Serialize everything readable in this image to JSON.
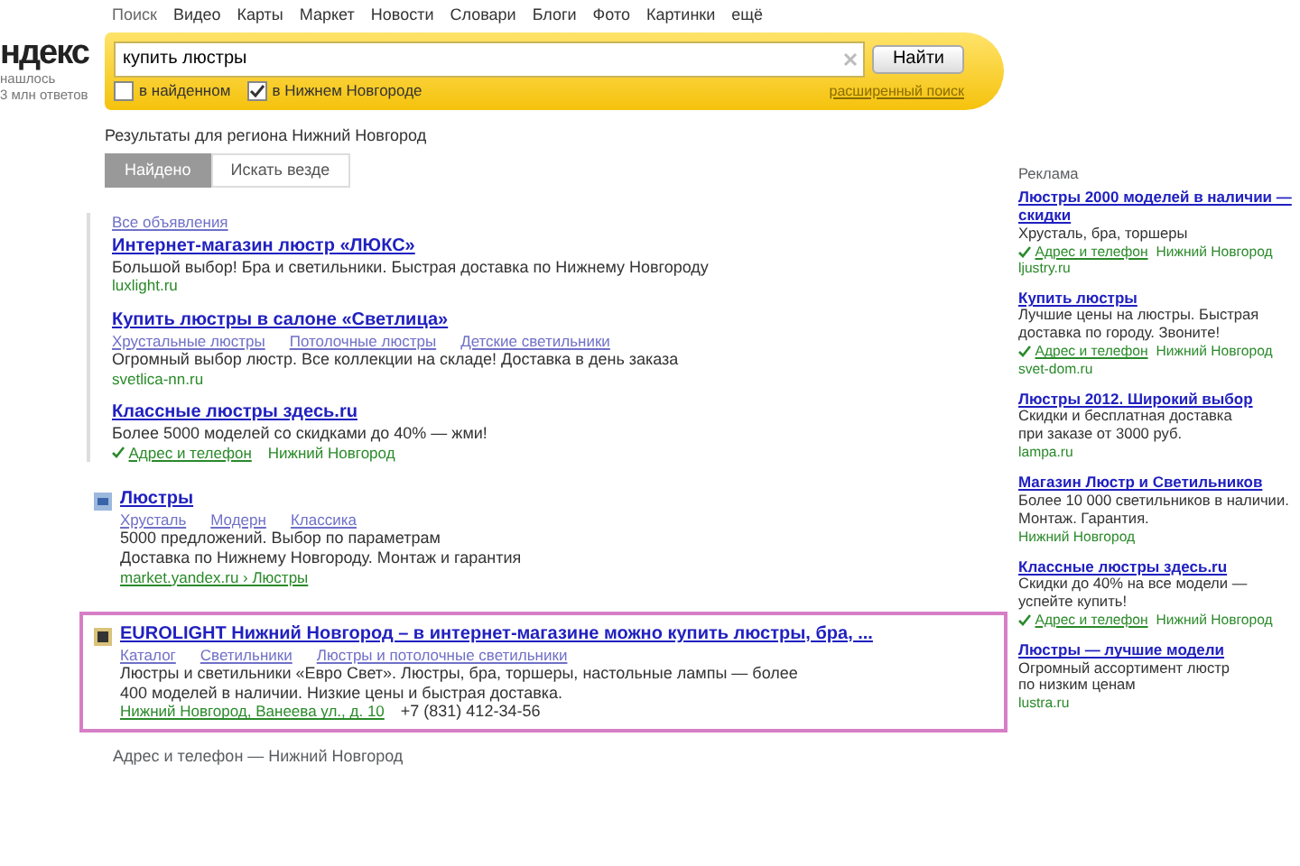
{
  "nav": [
    {
      "label": "Поиск",
      "selected": true
    },
    {
      "label": "Видео",
      "selected": false
    },
    {
      "label": "Карты",
      "selected": false
    },
    {
      "label": "Маркет",
      "selected": false
    },
    {
      "label": "Новости",
      "selected": false
    },
    {
      "label": "Словари",
      "selected": false
    },
    {
      "label": "Блоги",
      "selected": false
    },
    {
      "label": "Фото",
      "selected": false
    },
    {
      "label": "Картинки",
      "selected": false
    },
    {
      "label": "ещё",
      "selected": false
    }
  ],
  "logo": {
    "text": "ндекс",
    "lines": [
      "нашлось",
      "3 млн ответов"
    ]
  },
  "search": {
    "value": "купить люстры",
    "button": "Найти",
    "advanced": "расширенный поиск",
    "options": [
      {
        "label": "в найденном",
        "checked": false
      },
      {
        "label": "в Нижнем Новгороде",
        "checked": true
      }
    ]
  },
  "region_note": "Результаты для региона Нижний Новгород",
  "view_tabs": [
    {
      "label": "Найдено",
      "selected": true
    },
    {
      "label": "Искать везде",
      "selected": false
    }
  ],
  "ads": {
    "header": "Все объявления",
    "items": [
      {
        "title": "Интернет-магазин люстр «ЛЮКС»",
        "lines": [
          "Большой выбор! Бра и светильники. Быстрая доставка по Нижнему Новгороду"
        ],
        "url": "luxlight.ru"
      },
      {
        "title": "Купить люстры в салоне «Светлица»",
        "sitelinks": [
          "Хрустальные люстры",
          "Потолочные люстры",
          "Детские светильники"
        ],
        "lines": [
          "Огромный выбор люстр. Все коллекции на складе! Доставка в день заказа"
        ],
        "url": "svetlica-nn.ru"
      },
      {
        "title": "Классные люстры здесь.ru",
        "lines": [
          "Более 5000 моделей со скидками до 40% — жми!"
        ],
        "contact": "Адрес и телефон",
        "contact_extra": "Нижний Новгород"
      }
    ]
  },
  "results": [
    {
      "kind": "doc",
      "title": "Люстры",
      "sitelinks": [
        "Хрусталь",
        "Модерн",
        "Классика"
      ],
      "lines": [
        "5000 предложений. Выбор по параметрам",
        "Доставка по Нижнему Новгороду. Монтаж и гарантия"
      ],
      "url": "market.yandex.ru › Люстры",
      "highlighted": false
    },
    {
      "kind": "site",
      "title": "EUROLIGHT Нижний Новгород – в интернет-магазине можно купить люстры, бра, ...",
      "sitelinks": [
        "Каталог",
        "Светильники",
        "Люстры и потолочные светильники"
      ],
      "lines": [
        "Люстры и светильники «Евро Свет». Люстры, бра, торшеры, настольные лампы — более",
        "400 моделей в наличии. Низкие цены и быстрая доставка."
      ],
      "url": "Нижний Новгород, Ванеева ул., д. 10",
      "phone": "+7 (831) 412-34-56",
      "highlighted": true
    }
  ],
  "result_footer": "Адрес и телефон — Нижний Новгород",
  "right_ads": {
    "header": "Реклама",
    "items": [
      {
        "title": "Люстры 2000 моделей в наличии — скидки",
        "lines": [
          "Хрусталь, бра, торшеры"
        ],
        "contact": "Адрес и телефон",
        "extra": "Нижний Новгород",
        "url": "ljustry.ru"
      },
      {
        "title": "Купить люстры",
        "lines": [
          "Лучшие цены на люстры. Быстрая",
          "доставка по городу. Звоните!"
        ],
        "contact": "Адрес и телефон",
        "extra": "Нижний Новгород",
        "url": "svet-dom.ru"
      },
      {
        "title": "Люстры 2012. Широкий выбор",
        "lines": [
          "Скидки и бесплатная доставка",
          "при заказе от 3000 руб."
        ],
        "url": "lampa.ru"
      },
      {
        "title": "Магазин Люстр и Светильников",
        "lines": [
          "Более 10 000 светильников в наличии.",
          "Монтаж. Гарантия."
        ],
        "extra": "Нижний Новгород"
      },
      {
        "title": "Классные люстры здесь.ru",
        "lines": [
          "Скидки до 40% на все модели —",
          "успейте купить!"
        ],
        "contact": "Адрес и телефон",
        "extra": "Нижний Новгород"
      },
      {
        "title": "Люстры — лучшие модели",
        "lines": [
          "Огромный ассортимент люстр",
          "по низким ценам"
        ],
        "url": "lustra.ru"
      }
    ]
  }
}
